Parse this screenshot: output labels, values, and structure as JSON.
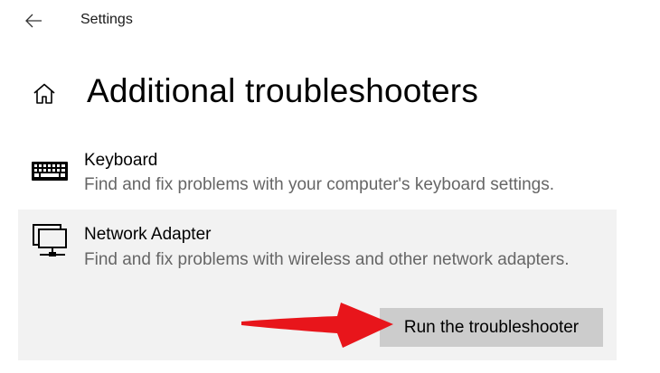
{
  "header": {
    "back_icon": "arrow-left-icon",
    "app_title": "Settings"
  },
  "page": {
    "home_icon": "home-icon",
    "title": "Additional troubleshooters"
  },
  "troubleshooters": [
    {
      "icon": "keyboard-icon",
      "name": "Keyboard",
      "description": "Find and fix problems with your computer's keyboard settings."
    },
    {
      "icon": "network-adapter-icon",
      "name": "Network Adapter",
      "description": "Find and fix problems with wireless and other network adapters.",
      "selected": true,
      "action_label": "Run the troubleshooter"
    }
  ],
  "annotation": {
    "arrow_color": "#e8151b"
  },
  "colors": {
    "selected_background": "#f2f2f2",
    "button_background": "#cccccc",
    "description_text": "#666666"
  }
}
